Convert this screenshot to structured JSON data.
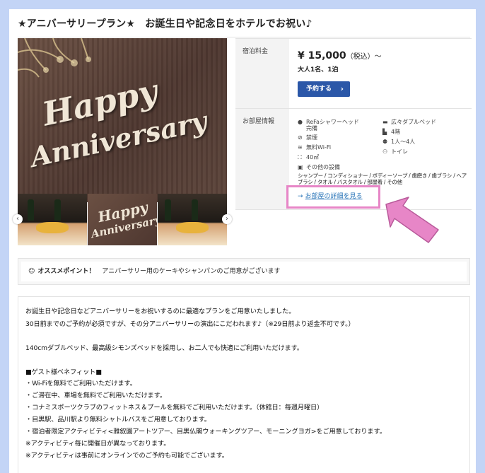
{
  "title": "★アニバーサリープラン★　お誕生日や記念日をホテルでお祝い♪",
  "image": {
    "main_line1": "Happy",
    "main_line2": "Anniversary",
    "thumb_line1": "Happy",
    "thumb_line2": "Anniversary",
    "prev_icon": "chevron-left-icon",
    "next_icon": "chevron-right-icon"
  },
  "rate": {
    "label": "宿泊料金",
    "price": "¥ 15,000",
    "tax": "（税込）〜",
    "persons": "大人1名、1泊",
    "reserve_label": "予約する",
    "reserve_color": "#2b57a8"
  },
  "room": {
    "label": "お部屋情報",
    "amenities_left": [
      {
        "icon": "person-icon",
        "text": "ReFaシャワーヘッド"
      },
      {
        "icon": "",
        "text": "完備"
      },
      {
        "icon": "no-smoking-icon",
        "text": "禁煙"
      },
      {
        "icon": "wifi-icon",
        "text": "無料Wi-Fi"
      },
      {
        "icon": "area-icon",
        "text": "40㎡"
      },
      {
        "icon": "box-icon",
        "text": "その他の設備"
      }
    ],
    "amenities_right": [
      {
        "icon": "bed-icon",
        "text": "広々ダブルベッド"
      },
      {
        "icon": "floor-icon",
        "text": "4階"
      },
      {
        "icon": "people-icon",
        "text": "1人〜4人"
      },
      {
        "icon": "toilet-icon",
        "text": "トイレ"
      }
    ],
    "other_equipment": "シャンプー / コンディショナー / ボディーソープ / 歯磨き / 歯ブラシ / ヘアブラシ / タオル / バスタオル / 部屋着 / その他",
    "detail_link": "お部屋の詳細を見る",
    "highlight_color": "#e786c7"
  },
  "recommend": {
    "icon": "smile-icon",
    "heading": "オススメポイント！",
    "text": "アニバーサリー用のケーキやシャンパンのご用意がございます"
  },
  "description": [
    "お誕生日や記念日などアニバーサリーをお祝いするのに最適なプランをご用意いたしました。",
    "30日前までのご予約が必須ですが、その分アニバーサリーの演出にこだわれます♪（※29日前より返金不可です。）",
    "",
    "140cmダブルベッド、最高級シモンズベッドを採用し、お二人でも快適にご利用いただけます。",
    "",
    "■ゲスト様ベネフィット■",
    "・Wi-Fiを無料でご利用いただけます。",
    "・ご滞在中、車場を無料でご利用いただけます。",
    "・コナミスポーツクラブのフィットネス＆プールを無料でご利用いただけます。（休館日：毎週月曜日）",
    "・目黒駅、品川駅より無料シャトルバスをご用意しております。",
    "・宿泊者限定アクティビティ<雅叙園アートツアー、目黒仏閣ウォーキングツアー、モーニングヨガ>をご用意しております。",
    "※アクティビティ毎に開催日が異なっております。",
    "※アクティビティは事前にオンラインでのご予約も可能でございます。"
  ]
}
